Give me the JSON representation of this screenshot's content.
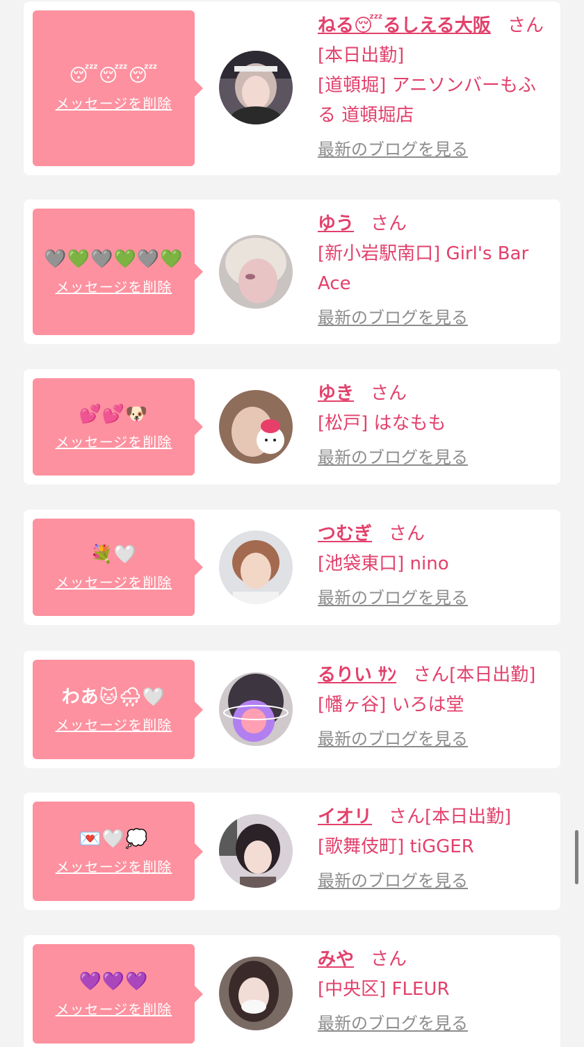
{
  "cards": [
    {
      "message": "😴😴😴",
      "delete_label": "メッセージを削除",
      "name": "ねる😴るしえる大阪",
      "honorific": "さん",
      "status": "[本日出勤]",
      "shop": "[道頓堀] アニソンバーもふる 道頓堀店",
      "blog_label": "最新のブログを見る"
    },
    {
      "message": "🩶💚🩶💚🩶💚",
      "delete_label": "メッセージを削除",
      "name": "ゆう",
      "honorific": "さん",
      "status": "",
      "shop": "[新小岩駅南口] Girl's Bar Ace",
      "blog_label": "最新のブログを見る"
    },
    {
      "message": "💕💕🐶",
      "delete_label": "メッセージを削除",
      "name": "ゆき",
      "honorific": "さん",
      "status": "",
      "shop": "[松戸] はなもも",
      "blog_label": "最新のブログを見る"
    },
    {
      "message": "💐🤍",
      "delete_label": "メッセージを削除",
      "name": "つむぎ",
      "honorific": "さん",
      "status": "",
      "shop": "[池袋東口] nino",
      "blog_label": "最新のブログを見る"
    },
    {
      "message": "わあ🐱🌧🤍",
      "delete_label": "メッセージを削除",
      "name": "るりい ｻﾝ",
      "honorific": "さん",
      "status": "[本日出勤]",
      "shop": "[幡ヶ谷] いろは堂",
      "blog_label": "最新のブログを見る"
    },
    {
      "message": "💌🤍💭",
      "delete_label": "メッセージを削除",
      "name": "イオリ",
      "honorific": "さん",
      "status": "[本日出勤]",
      "shop": "[歌舞伎町] tiGGER",
      "blog_label": "最新のブログを見る"
    },
    {
      "message": "💜💜💜",
      "delete_label": "メッセージを削除",
      "name": "みや",
      "honorific": "さん",
      "status": "",
      "shop": "[中央区] FLEUR",
      "blog_label": "最新のブログを見る"
    }
  ],
  "colors": {
    "accent_pink": "#e2406b",
    "bubble_pink": "#fd919f",
    "link_gray": "#8c8c8c",
    "background": "#f3f3f3"
  }
}
